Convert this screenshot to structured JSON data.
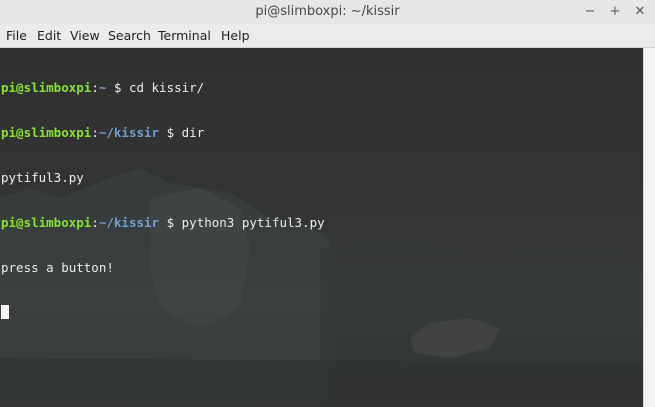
{
  "window": {
    "title": "pi@slimboxpi: ~/kissir"
  },
  "controls": {
    "minimize": "−",
    "maximize": "+",
    "close": "✕"
  },
  "menu": [
    "File",
    "Edit",
    "View",
    "Search",
    "Terminal",
    "Help"
  ],
  "terminal": {
    "lines": [
      {
        "user": "pi@slimboxpi",
        "sep": ":",
        "path": "~",
        "prompt": " $ ",
        "cmd": "cd kissir/"
      },
      {
        "user": "pi@slimboxpi",
        "sep": ":",
        "path": "~/kissir",
        "prompt": " $ ",
        "cmd": "dir"
      },
      {
        "output": "pytiful3.py"
      },
      {
        "user": "pi@slimboxpi",
        "sep": ":",
        "path": "~/kissir",
        "prompt": " $ ",
        "cmd": "python3 pytiful3.py"
      },
      {
        "output": "press a button!"
      }
    ]
  },
  "colors": {
    "user": "#8ae234",
    "path": "#729fcf",
    "text": "#ededed",
    "background": "#333333"
  }
}
